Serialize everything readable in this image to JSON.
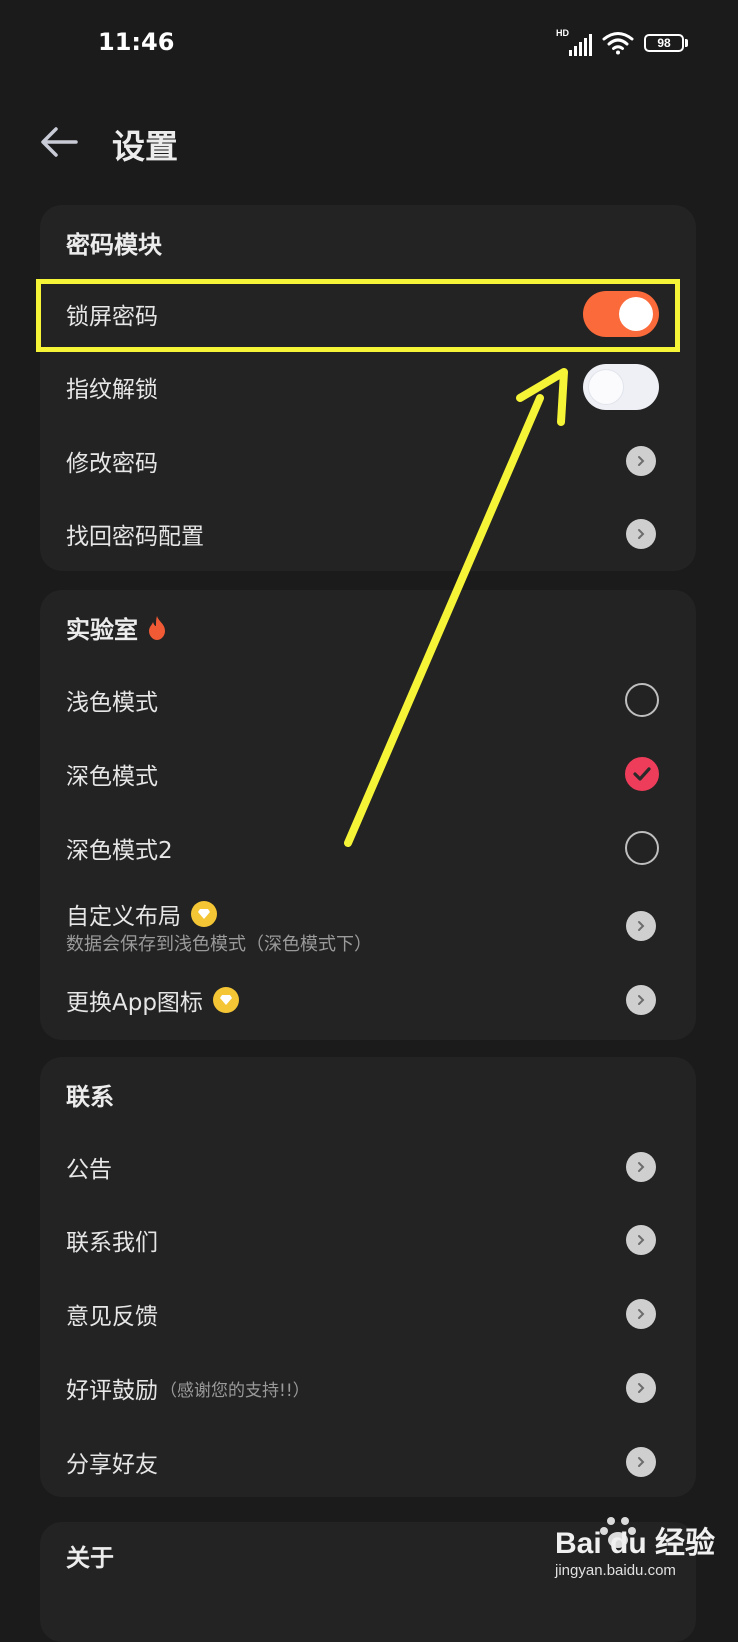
{
  "status_bar": {
    "time": "11:46",
    "network": "HD",
    "battery": "98"
  },
  "header": {
    "title": "设置"
  },
  "password_section": {
    "title": "密码模块",
    "items": [
      {
        "label": "锁屏密码",
        "control": "toggle",
        "state": "on"
      },
      {
        "label": "指纹解锁",
        "control": "toggle",
        "state": "off"
      },
      {
        "label": "修改密码",
        "control": "chevron"
      },
      {
        "label": "找回密码配置",
        "control": "chevron"
      }
    ]
  },
  "lab_section": {
    "title": "实验室",
    "items": [
      {
        "label": "浅色模式",
        "control": "radio",
        "selected": false
      },
      {
        "label": "深色模式",
        "control": "radio",
        "selected": true
      },
      {
        "label": "深色模式2",
        "control": "radio",
        "selected": false
      },
      {
        "label": "自定义布局",
        "subtitle": "数据会保存到浅色模式（深色模式下）",
        "control": "chevron",
        "badge": "vip-diamond-icon"
      },
      {
        "label": "更换App图标",
        "control": "chevron",
        "badge": "vip-diamond-icon"
      }
    ]
  },
  "contact_section": {
    "title": "联系",
    "items": [
      {
        "label": "公告",
        "control": "chevron"
      },
      {
        "label": "联系我们",
        "control": "chevron"
      },
      {
        "label": "意见反馈",
        "control": "chevron"
      },
      {
        "label": "好评鼓励",
        "note": "（感谢您的支持!!）",
        "control": "chevron"
      },
      {
        "label": "分享好友",
        "control": "chevron"
      }
    ]
  },
  "about_section": {
    "title": "关于"
  },
  "watermark": {
    "main": "Bai du 经验",
    "sub": "jingyan.baidu.com"
  },
  "colors": {
    "toggle_on": "#fa6a3a",
    "radio_selected": "#ee3d5a",
    "highlight": "#f6f436",
    "vip_badge": "#f4c534"
  }
}
